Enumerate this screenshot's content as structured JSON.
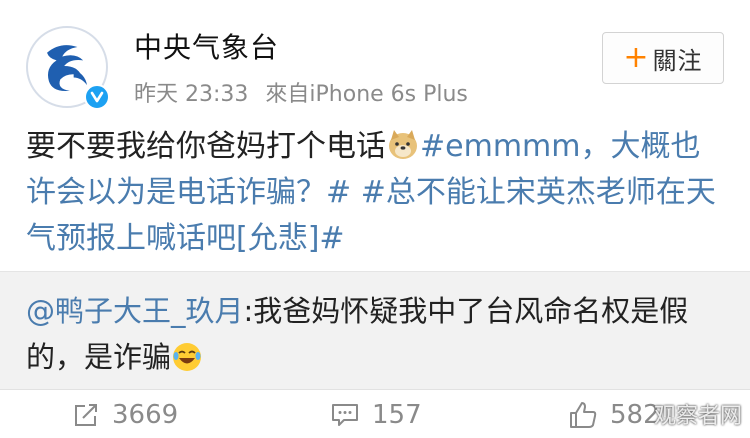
{
  "post": {
    "username": "中央气象台",
    "time": "昨天 23:33",
    "source": "來自iPhone 6s Plus",
    "follow": {
      "plus": "+",
      "label": "關注"
    },
    "content": {
      "line1_text": "要不要我给你爸妈打个电话",
      "line1_emoji": "doge-emoji",
      "topic1": "#emmmm，大概也许会以为是电话诈骗？#",
      "topic2": "#总不能让宋英杰老师在天气预报上喊话吧[允悲]#"
    },
    "retweet": {
      "mention": "@鸭子大王_玖月",
      "text": ":我爸妈怀疑我中了台风命名权是假的，是诈骗",
      "emoji": "laugh-cry-emoji"
    },
    "actions": {
      "repost_count": "3669",
      "comment_count": "157",
      "like_count": "582"
    },
    "watermark": "观察者网"
  },
  "colors": {
    "link": "#4a7cae",
    "follow_plus": "#ff8200",
    "meta": "#8a8a8a",
    "retweet_bg": "#f2f2f2",
    "verified": "#1da1f2"
  },
  "icons": [
    "verified-icon",
    "repost-icon",
    "comment-icon",
    "like-icon"
  ]
}
